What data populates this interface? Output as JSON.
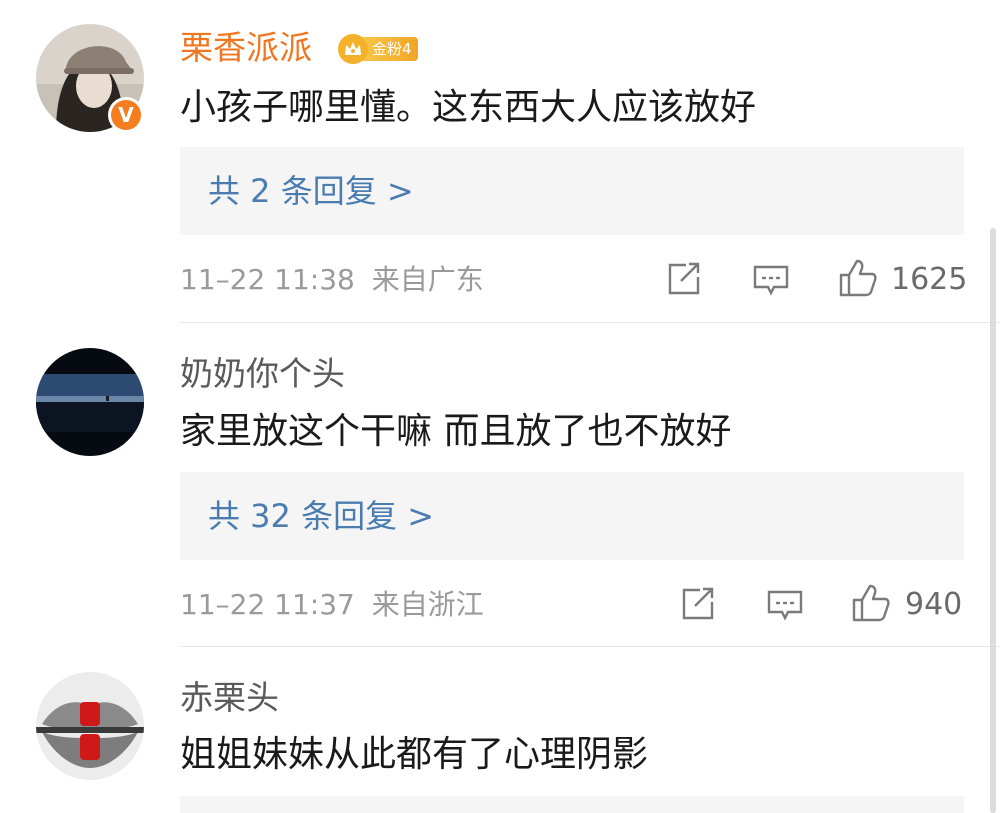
{
  "colors": {
    "vip_name": "#f0761f",
    "reply_link": "#4a7cb0",
    "meta": "#9a9a9a",
    "reply_bg": "#f5f5f5"
  },
  "comments": [
    {
      "username": "栗香派派",
      "verified_badge": "V",
      "fan_badge": "金粉4",
      "text": "小孩子哪里懂。这东西大人应该放好",
      "reply_label": "共 2 条回复 >",
      "time": "11–22 11:38",
      "location": "来自广东",
      "likes": "1625"
    },
    {
      "username": "奶奶你个头",
      "text": "家里放这个干嘛 而且放了也不放好",
      "reply_label": "共 32 条回复 >",
      "time": "11–22 11:37",
      "location": "来自浙江",
      "likes": "940"
    },
    {
      "username": "赤栗头",
      "text": "姐姐妹妹从此都有了心理阴影"
    }
  ]
}
